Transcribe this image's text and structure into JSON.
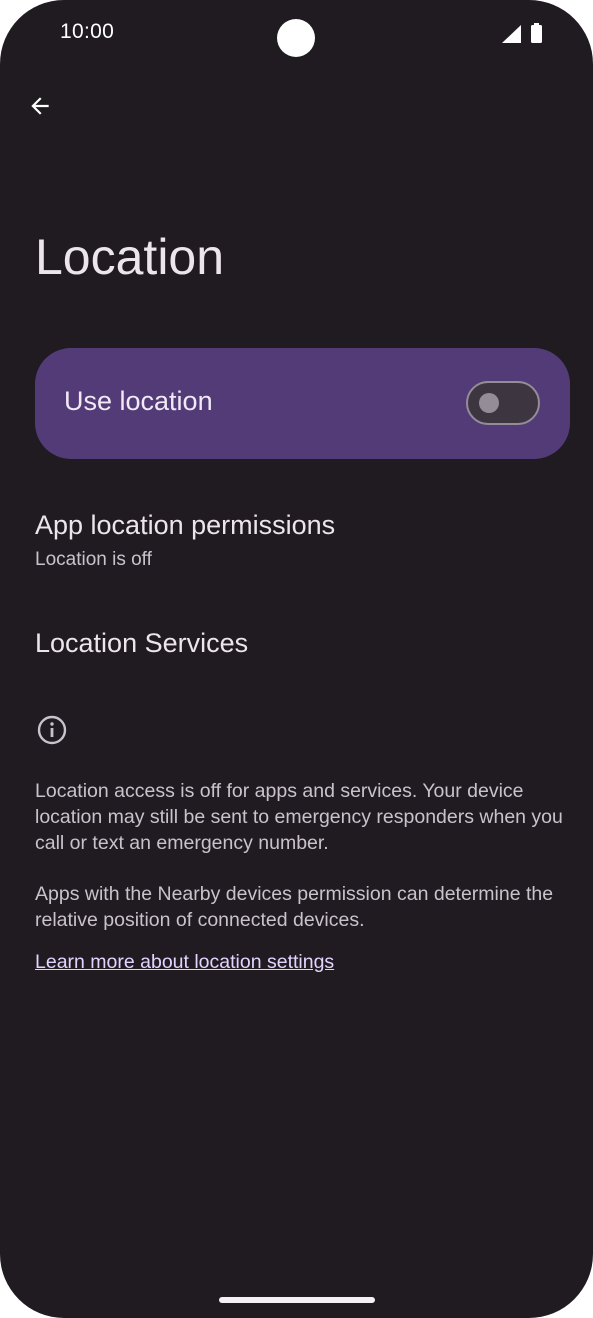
{
  "status_bar": {
    "time": "10:00",
    "icons": [
      "signal-icon",
      "battery-icon"
    ]
  },
  "header": {
    "back_icon": "arrow-back-icon",
    "title": "Location"
  },
  "use_location": {
    "label": "Use location",
    "enabled": false
  },
  "items": [
    {
      "title": "App location permissions",
      "summary": "Location is off"
    },
    {
      "title": "Location Services"
    }
  ],
  "footer": {
    "icon": "info-icon",
    "paragraph_1": "Location access is off for apps and services. Your device location may still be sent to emergency responders when you call or text an emergency number.",
    "paragraph_2": "Apps with the Nearby devices permission can determine the relative position of connected devices.",
    "link_text": "Learn more about location settings"
  },
  "colors": {
    "background": "#1f1b21",
    "card": "#533b78",
    "link": "#e4d3ff"
  }
}
